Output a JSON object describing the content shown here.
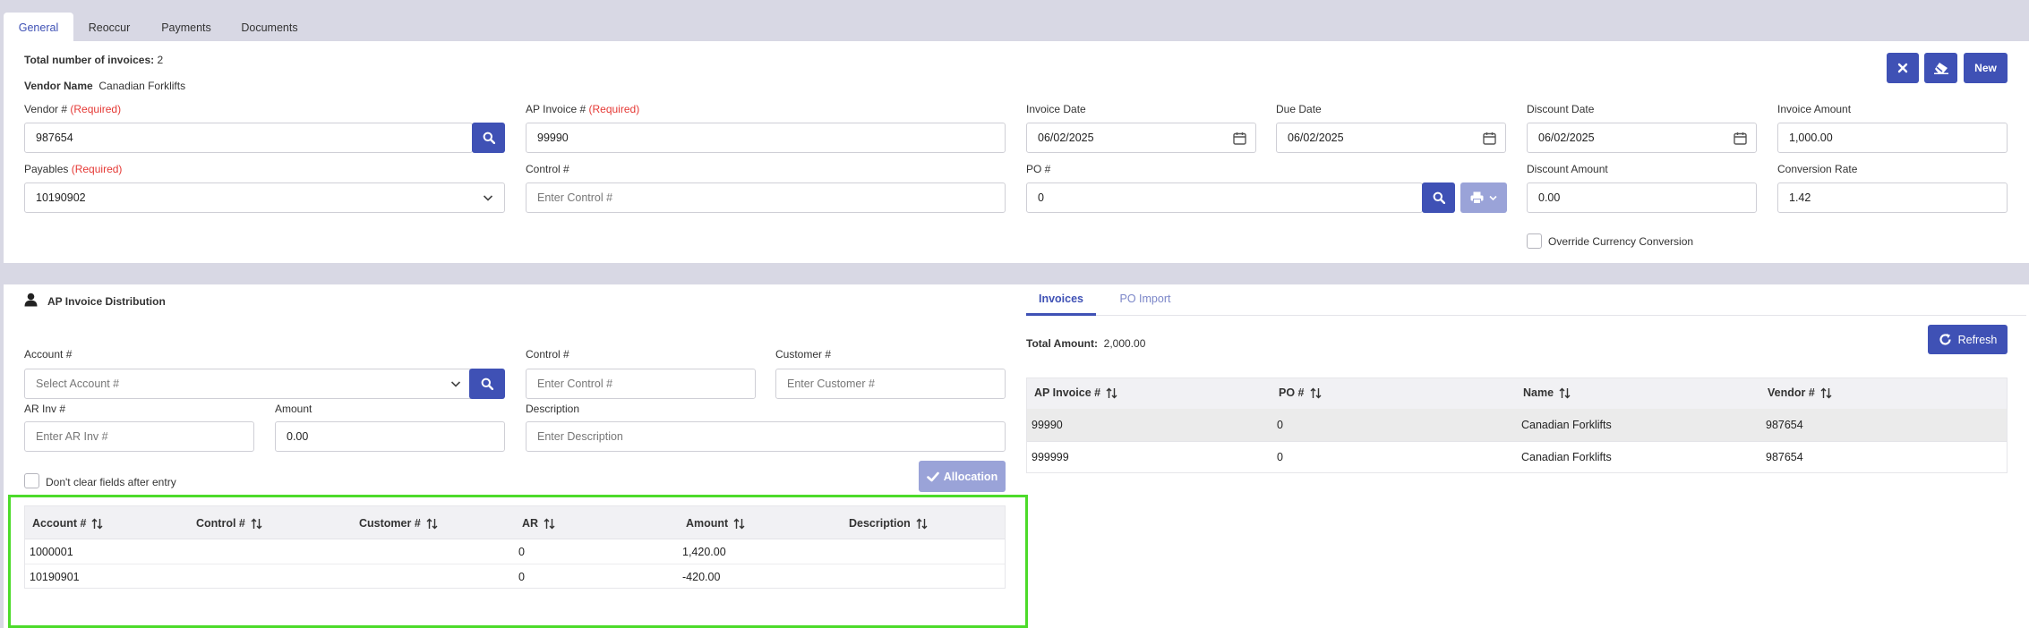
{
  "tabs": [
    "General",
    "Reoccur",
    "Payments",
    "Documents"
  ],
  "header": {
    "total_invoices_label": "Total number of invoices:",
    "total_invoices_value": "2",
    "vendor_name_label": "Vendor Name",
    "vendor_name_value": "Canadian Forklifts",
    "new_label": "New"
  },
  "form": {
    "vendor_label": "Vendor #",
    "required": "(Required)",
    "vendor_value": "987654",
    "ap_invoice_label": "AP Invoice #",
    "ap_invoice_value": "99990",
    "invoice_date_label": "Invoice Date",
    "invoice_date_value": "06/02/2025",
    "due_date_label": "Due Date",
    "due_date_value": "06/02/2025",
    "discount_date_label": "Discount Date",
    "discount_date_value": "06/02/2025",
    "invoice_amount_label": "Invoice Amount",
    "invoice_amount_value": "1,000.00",
    "payables_label": "Payables",
    "payables_value": "10190902",
    "control_label": "Control #",
    "control_placeholder": "Enter Control #",
    "po_label": "PO #",
    "po_value": "0",
    "discount_amount_label": "Discount Amount",
    "discount_amount_value": "0.00",
    "conversion_rate_label": "Conversion Rate",
    "conversion_rate_value": "1.42",
    "override_label": "Override Currency Conversion"
  },
  "distribution": {
    "title": "AP Invoice Distribution",
    "account_label": "Account #",
    "account_placeholder": "Select Account #",
    "control_label": "Control #",
    "control_placeholder": "Enter Control #",
    "customer_label": "Customer #",
    "customer_placeholder": "Enter Customer #",
    "ar_label": "AR Inv #",
    "ar_placeholder": "Enter AR Inv #",
    "amount_label": "Amount",
    "amount_value": "0.00",
    "description_label": "Description",
    "description_placeholder": "Enter Description",
    "dont_clear_label": "Don't clear fields after entry",
    "allocation_label": "Allocation",
    "columns": [
      "Account #",
      "Control #",
      "Customer #",
      "AR",
      "Amount",
      "Description"
    ],
    "rows": [
      [
        "1000001",
        "",
        "",
        "0",
        "1,420.00",
        ""
      ],
      [
        "10190901",
        "",
        "",
        "0",
        "-420.00",
        ""
      ]
    ]
  },
  "invoices_panel": {
    "tabs": [
      "Invoices",
      "PO Import"
    ],
    "total_label": "Total Amount:",
    "total_value": "2,000.00",
    "refresh_label": "Refresh",
    "columns": [
      "AP Invoice #",
      "PO #",
      "Name",
      "Vendor #"
    ],
    "rows": [
      [
        "99990",
        "0",
        "Canadian Forklifts",
        "987654"
      ],
      [
        "999999",
        "0",
        "Canadian Forklifts",
        "987654"
      ]
    ]
  },
  "colors": {
    "accent": "#3f51b5",
    "required": "#e53935",
    "highlight": "#4cdb2a"
  }
}
